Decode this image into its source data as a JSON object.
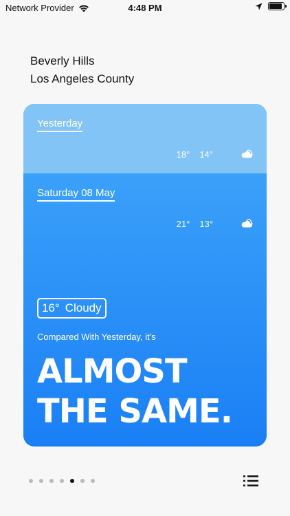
{
  "status_bar": {
    "carrier": "Network Provider",
    "time": "4:48 PM",
    "battery_level": 0.9
  },
  "location": {
    "city": "Beverly Hills",
    "county": "Los Angeles County"
  },
  "card": {
    "yesterday": {
      "label": "Yesterday",
      "high": "18°",
      "low": "14°",
      "icon": "cloud-icon"
    },
    "today": {
      "label": "Saturday 08 May",
      "high": "21°",
      "low": "13°",
      "icon": "cloud-icon"
    },
    "current": {
      "temperature": "16°",
      "condition": "Cloudy"
    },
    "compared_text": "Compared With Yesterday, it's",
    "headline_line1": "ALMOST",
    "headline_line2": "THE SAME.",
    "colors": {
      "yesterday_band": "#82c4f5",
      "gradient_top": "#43a9fa",
      "gradient_bottom": "#1a7ff5"
    }
  },
  "pager": {
    "total": 7,
    "active_index": 4
  },
  "toolbar": {
    "list_icon": "list-icon"
  }
}
